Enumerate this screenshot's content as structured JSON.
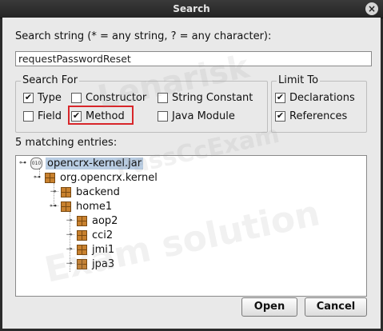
{
  "window": {
    "title": "Search",
    "close_glyph": "×"
  },
  "search_string": {
    "label": "Search string (* = any string, ? = any character):",
    "value": "requestPasswordReset"
  },
  "search_for": {
    "title": "Search For",
    "options": [
      {
        "label": "Type",
        "checked": true
      },
      {
        "label": "Constructor",
        "checked": false
      },
      {
        "label": "String Constant",
        "checked": false
      },
      {
        "label": "Field",
        "checked": false
      },
      {
        "label": "Method",
        "checked": true
      },
      {
        "label": "Java Module",
        "checked": false
      }
    ]
  },
  "limit_to": {
    "title": "Limit To",
    "options": [
      {
        "label": "Declarations",
        "checked": true
      },
      {
        "label": "References",
        "checked": true
      }
    ]
  },
  "results": {
    "label": "5 matching entries:",
    "tree": {
      "root": "opencrx-kernel.jar",
      "package": "org.opencrx.kernel",
      "children": [
        "backend",
        "home1"
      ],
      "home1_children": [
        "aop2",
        "cci2",
        "jmi1",
        "jpa3"
      ]
    }
  },
  "buttons": {
    "open": "Open",
    "cancel": "Cancel"
  },
  "watermark": {
    "line1": "Lenarisk",
    "line2": "PassCcExam",
    "line3": "Exam solution"
  },
  "colors": {
    "highlight_border": "#d8262a",
    "selection": "#b9cde3",
    "package_icon": "#c8812e"
  }
}
